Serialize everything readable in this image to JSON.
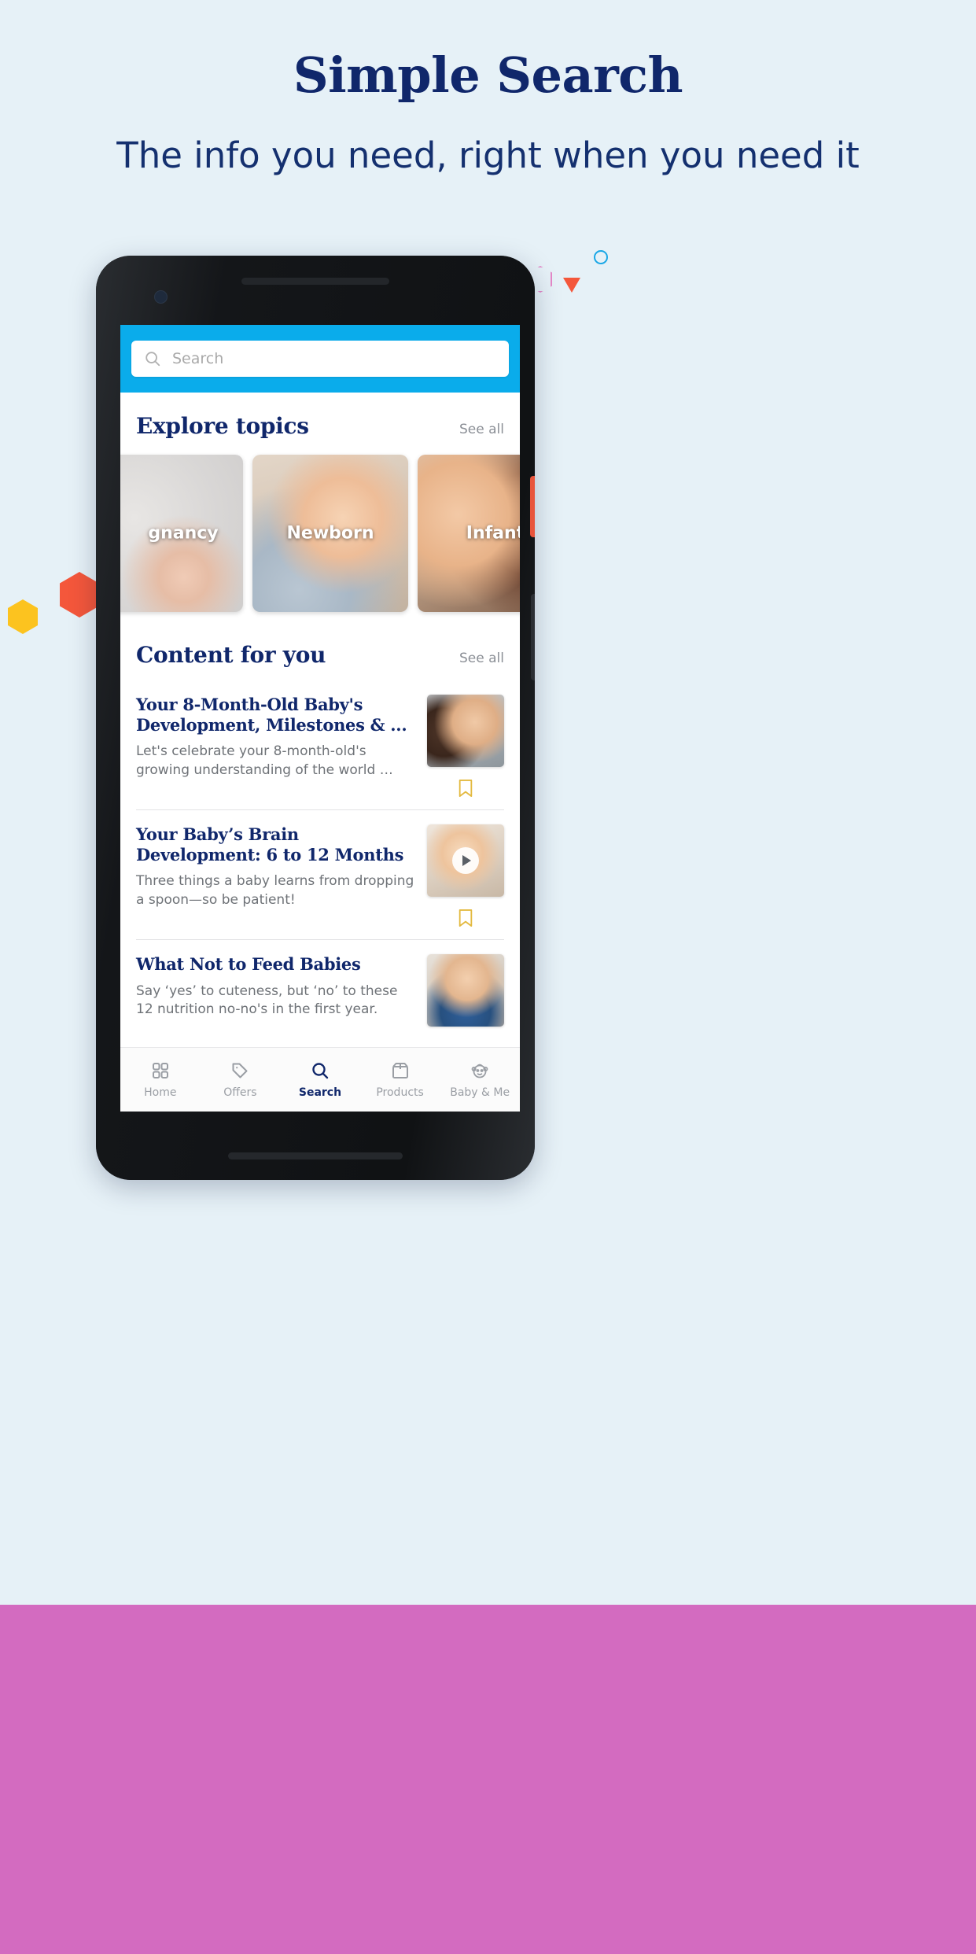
{
  "page": {
    "headline": "Simple Search",
    "subheadline": "The info you need, right when you need it",
    "background_top_color": "#e6f1f7",
    "background_bottom_color": "#d36bc0",
    "brand_navy": "#10276b",
    "brand_blue": "#0aaceb"
  },
  "app": {
    "search": {
      "placeholder": "Search",
      "value": "",
      "icon": "search-icon"
    },
    "explore": {
      "title": "Explore topics",
      "see_all_label": "See all",
      "cards": [
        {
          "label": "Pregnancy",
          "visible_label": "gnancy",
          "photo": "pregnancy-photo"
        },
        {
          "label": "Newborn",
          "visible_label": "Newborn",
          "photo": "newborn-photo"
        },
        {
          "label": "Infant",
          "visible_label": "Infant",
          "photo": "infant-photo"
        }
      ]
    },
    "content": {
      "title": "Content for you",
      "see_all_label": "See all",
      "articles": [
        {
          "title": "Your 8-Month-Old Baby's Development, Milestones & ...",
          "description": "Let's celebrate your 8-month-old's growing understanding of the world …",
          "thumb": "baby-development-photo",
          "has_video": false,
          "bookmark_icon": "bookmark-icon"
        },
        {
          "title": "Your Baby’s Brain Development: 6 to 12 Months",
          "description": "Three things a baby learns from dropping a spoon—so be patient!",
          "thumb": "baby-brain-photo",
          "has_video": true,
          "bookmark_icon": "bookmark-icon"
        },
        {
          "title": "What Not to Feed Babies",
          "description": "Say ‘yes’ to cuteness, but ‘no’ to these 12 nutrition no-no's in the first year.",
          "thumb": "baby-feeding-photo",
          "has_video": false,
          "bookmark_icon": "bookmark-icon"
        }
      ]
    },
    "tabbar": {
      "active": "Search",
      "tabs": [
        {
          "label": "Home",
          "icon": "grid-icon"
        },
        {
          "label": "Offers",
          "icon": "tag-icon"
        },
        {
          "label": "Search",
          "icon": "search-icon"
        },
        {
          "label": "Products",
          "icon": "box-icon"
        },
        {
          "label": "Baby & Me",
          "icon": "baby-face-icon"
        }
      ]
    }
  }
}
